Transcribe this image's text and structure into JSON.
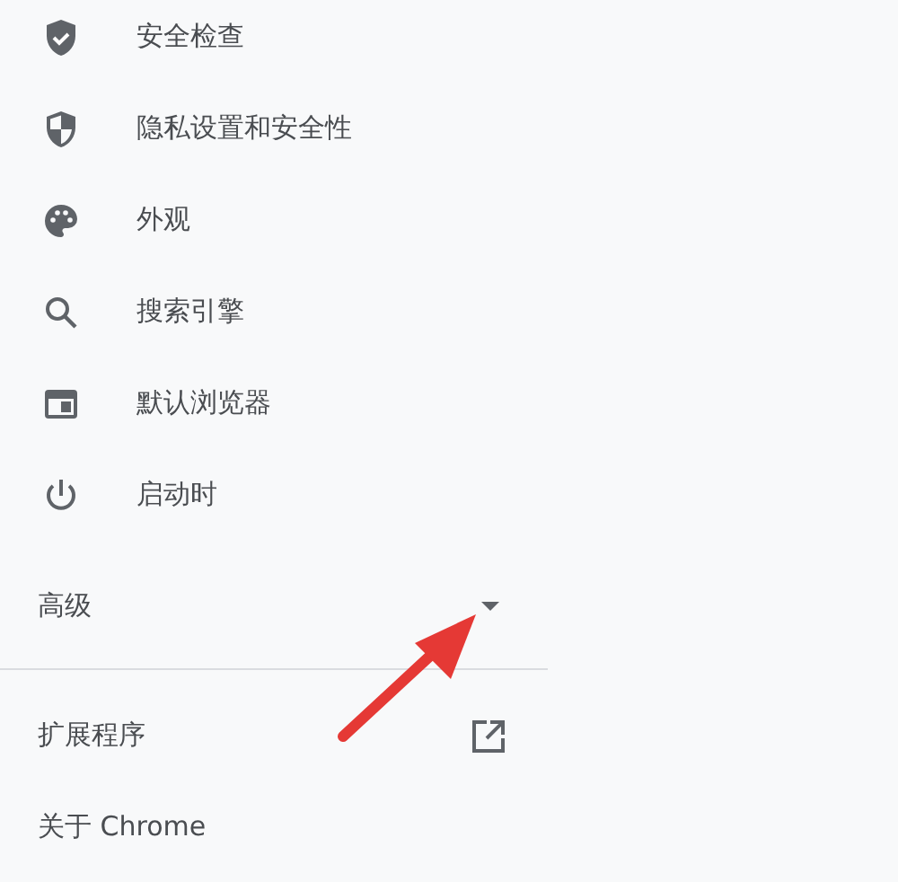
{
  "sidebar": {
    "items": [
      {
        "label": "安全检查"
      },
      {
        "label": "隐私设置和安全性"
      },
      {
        "label": "外观"
      },
      {
        "label": "搜索引擎"
      },
      {
        "label": "默认浏览器"
      },
      {
        "label": "启动时"
      }
    ],
    "advanced": {
      "label": "高级",
      "expanded": false
    },
    "links": [
      {
        "label": "扩展程序"
      },
      {
        "label": "关于 Chrome"
      }
    ]
  }
}
